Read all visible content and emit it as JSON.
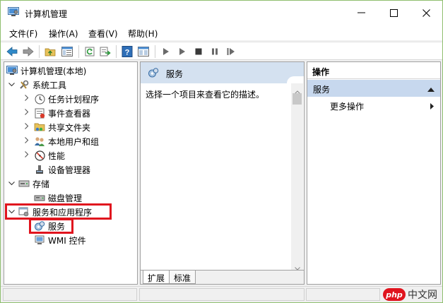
{
  "window": {
    "title": "计算机管理"
  },
  "menu": [
    "文件(F)",
    "操作(A)",
    "查看(V)",
    "帮助(H)"
  ],
  "toolbar": {
    "icons": [
      "back-arrow-icon",
      "forward-arrow-icon",
      "up-folder-icon",
      "show-hide-tree-icon",
      "refresh-icon",
      "export-list-icon",
      "help-icon",
      "properties-icon",
      "play-icon",
      "play-alt-icon",
      "stop-icon",
      "pause-icon",
      "restart-icon"
    ]
  },
  "tree": {
    "root": "计算机管理(本地)",
    "system_tools": "系统工具",
    "task_scheduler": "任务计划程序",
    "event_viewer": "事件查看器",
    "shared_folders": "共享文件夹",
    "local_users": "本地用户和组",
    "performance": "性能",
    "device_manager": "设备管理器",
    "storage": "存储",
    "disk_management": "磁盘管理",
    "services_apps": "服务和应用程序",
    "services": "服务",
    "wmi": "WMI 控件"
  },
  "middle": {
    "header": "服务",
    "description": "选择一个项目来查看它的描述。",
    "tabs": [
      "扩展",
      "标准"
    ]
  },
  "actions": {
    "title": "操作",
    "group": "服务",
    "more": "更多操作"
  },
  "watermark": {
    "badge": "php",
    "site": "中文网"
  },
  "colors": {
    "highlight_box": "#e0141e",
    "header_bg": "#d4e1f0",
    "group_bg": "#c7d8ee",
    "window_border": "#8fbf6f"
  }
}
